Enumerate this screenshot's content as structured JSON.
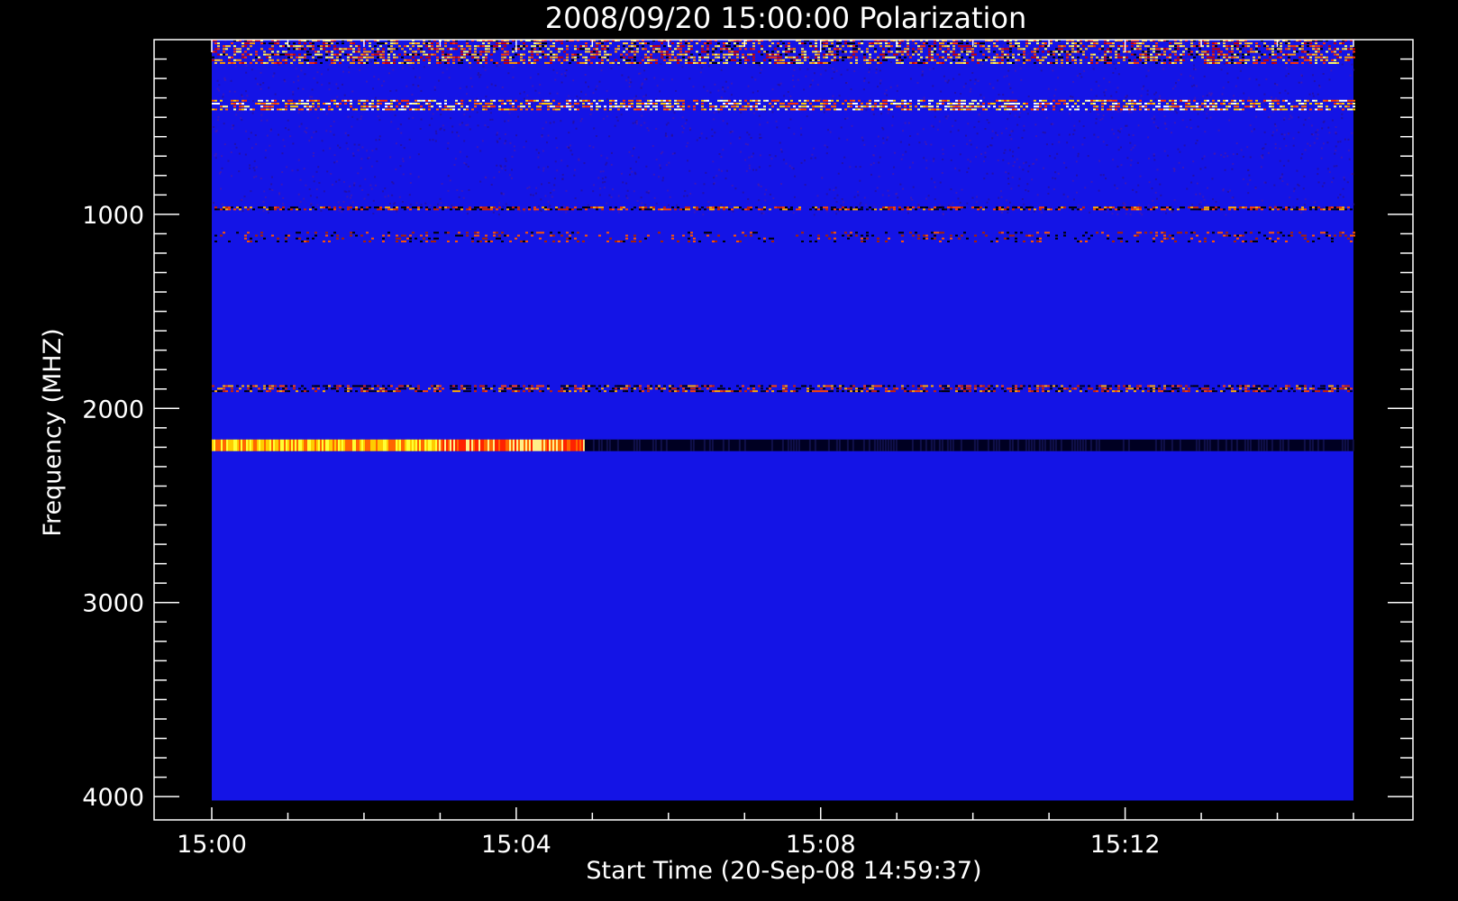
{
  "chart_data": {
    "type": "heatmap",
    "title": "2008/09/20 15:00:00 Polarization",
    "xlabel": "Start Time (20-Sep-08 14:59:37)",
    "ylabel": "Frequency (MHZ)",
    "x_tick_labels": [
      "15:00",
      "15:04",
      "15:08",
      "15:12"
    ],
    "x_tick_minutes": [
      0,
      4,
      8,
      12
    ],
    "x_range_minutes": [
      0,
      15
    ],
    "y_ticks": [
      1000,
      2000,
      3000,
      4000
    ],
    "y_tick_labels": [
      "1000",
      "2000",
      "3000",
      "4000"
    ],
    "y_range": [
      100,
      4120
    ],
    "y_inverted": true,
    "data_freq_range": [
      100,
      4020
    ],
    "background_color": "#1414e6",
    "features": [
      {
        "freq": [
          100,
          230
        ],
        "t": [
          0,
          15
        ],
        "kind": "noisy"
      },
      {
        "freq": [
          410,
          470
        ],
        "t": [
          0,
          15
        ],
        "kind": "bright"
      },
      {
        "freq": [
          960,
          980
        ],
        "t": [
          0,
          15
        ],
        "kind": "mixed"
      },
      {
        "freq": [
          1090,
          1150
        ],
        "t": [
          0,
          15
        ],
        "kind": "sparse"
      },
      {
        "freq": [
          1880,
          1920
        ],
        "t": [
          0,
          15
        ],
        "kind": "mixed"
      },
      {
        "freq": [
          2160,
          2220
        ],
        "t": [
          0,
          4.9
        ],
        "kind": "burst"
      },
      {
        "freq": [
          2160,
          2220
        ],
        "t": [
          4.9,
          15
        ],
        "kind": "dark"
      }
    ]
  }
}
